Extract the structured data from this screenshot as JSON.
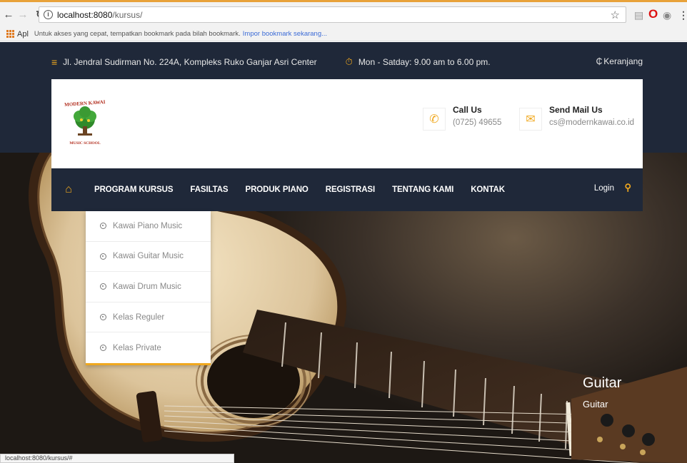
{
  "browser": {
    "url_host": "localhost:8080",
    "url_path": "/kursus/",
    "bookmark_apps": "Apl",
    "bookmark_hint": "Untuk akses yang cepat, tempatkan bookmark pada bilah bookmark.",
    "bookmark_link": "Impor bookmark sekarang...",
    "status_url": "localhost:8080/kursus/#"
  },
  "topbar": {
    "address": "Jl. Jendral Sudirman No. 224A, Kompleks Ruko Ganjar Asri Center",
    "hours": "Mon - Satday: 9.00 am to 6.00 pm.",
    "cart": "Keranjang"
  },
  "header": {
    "logo_text_top": "MODERN KAWAI",
    "logo_text_bottom": "MUSIC SCHOOL",
    "call_title": "Call Us",
    "call_value": "(0725) 49655",
    "mail_title": "Send Mail Us",
    "mail_value": "cs@modernkawai.co.id"
  },
  "nav": {
    "items": [
      "PROGRAM KURSUS",
      "FASILTAS",
      "PRODUK PIANO",
      "REGISTRASI",
      "TENTANG KAMI",
      "KONTAK"
    ],
    "login": "Login"
  },
  "dropdown": {
    "items": [
      "Kawai Piano Music",
      "Kawai Guitar Music",
      "Kawai Drum Music",
      "Kelas Reguler",
      "Kelas Private"
    ]
  },
  "slide": {
    "title": "Guitar",
    "subtitle": "Guitar"
  },
  "colors": {
    "accent": "#f0a81e",
    "navy": "#1f2839"
  }
}
